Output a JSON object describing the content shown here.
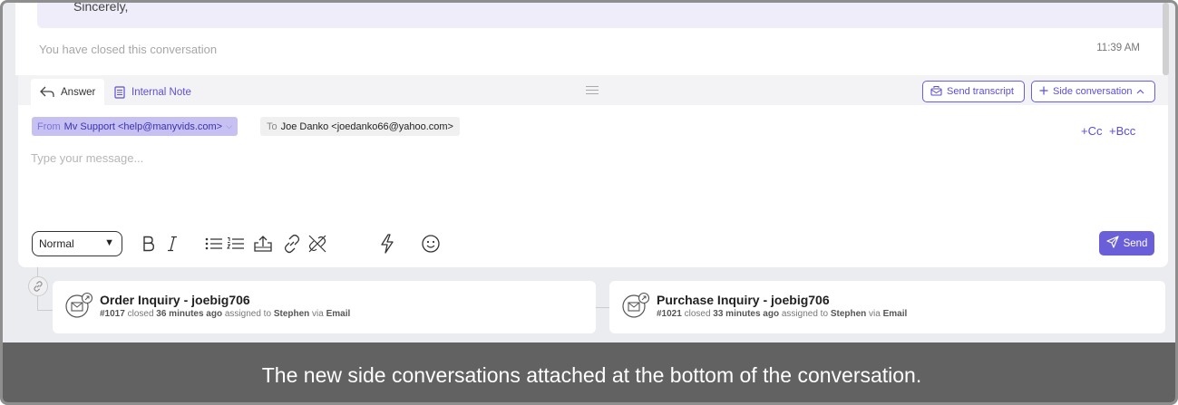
{
  "previous_message": {
    "text": "Sincerely,"
  },
  "conversation": {
    "closed_text": "You have closed this conversation",
    "closed_time": "11:39 AM"
  },
  "composer": {
    "tabs": [
      {
        "label": "Answer",
        "icon": "reply-icon",
        "active": true
      },
      {
        "label": "Internal Note",
        "icon": "note-icon",
        "active": false
      }
    ],
    "send_transcript_label": "Send transcript",
    "side_conversation_label": "Side conversation",
    "from_label": "From",
    "from_value": "Mv Support <help@manyvids.com>",
    "to_label": "To",
    "to_value": "Joe Danko <joedanko66@yahoo.com>",
    "cc_label": "+Cc",
    "bcc_label": "+Bcc",
    "message_placeholder": "Type your message...",
    "format_select": "Normal",
    "send_label": "Send",
    "accent_color": "#6a5fd8"
  },
  "side_conversations": [
    {
      "title": "Order Inquiry - joebig706",
      "number": "#1017",
      "status": "closed",
      "age": "36 minutes ago",
      "assigned_text": "assigned to",
      "assignee": "Stephen",
      "via_text": "via",
      "channel": "Email"
    },
    {
      "title": "Purchase Inquiry - joebig706",
      "number": "#1021",
      "status": "closed",
      "age": "33 minutes ago",
      "assigned_text": "assigned to",
      "assignee": "Stephen",
      "via_text": "via",
      "channel": "Email"
    }
  ],
  "caption": "The new side conversations attached at the bottom of the conversation."
}
